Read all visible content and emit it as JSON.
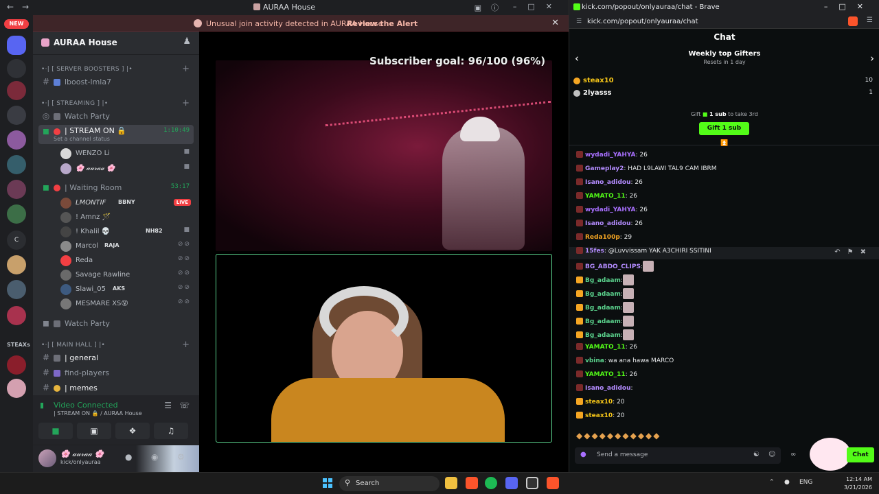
{
  "discord": {
    "window_title": "AURAA House",
    "alert": {
      "text": "Unusual join activity detected in AURAA House",
      "action": "Review the Alert"
    },
    "rail": {
      "new_badge": "NEW",
      "letter": "C",
      "label": "STEAXs"
    },
    "guild_name": "AURAA House",
    "categories": {
      "boosters": "•·| [ SERVER BOOSTERS ] |•",
      "streaming": "•·| [ STREAMING ] |•",
      "main_hall": "•·| [ MAIN HALL ] |•"
    },
    "channels": {
      "boost": "lboost-lmla7",
      "watch_party_1": "Watch Party",
      "stream_on": "| STREAM ON 🔒",
      "stream_on_time": "1:10:49",
      "stream_on_status": "Set a channel status",
      "waiting_room": "| Waiting Room",
      "waiting_room_time": "53:17",
      "watch_party_2": "Watch Party",
      "general": "| general",
      "find_players": "find-players",
      "memes": "| memes"
    },
    "stream_users": [
      {
        "name": "WENZO Li"
      },
      {
        "name": "🌸 𝒶𝓊𝓇𝒶𝒶 🌸"
      }
    ],
    "waiting_users": [
      {
        "name": "LMONTIF",
        "tag": "BBNY",
        "live": "LIVE"
      },
      {
        "name": "! Amnz 🪄",
        "tag": ""
      },
      {
        "name": "! Khalil 💀",
        "tag": "NH82"
      },
      {
        "name": "Marcol",
        "tag": "RAJA"
      },
      {
        "name": "Reda",
        "tag": ""
      },
      {
        "name": "Savage Rawline",
        "tag": ""
      },
      {
        "name": "Slawi_05",
        "tag": "AKS"
      },
      {
        "name": "MESMARE XS😵",
        "tag": ""
      }
    ],
    "voice": {
      "title": "Video Connected",
      "sub": "| STREAM ON 🔒 / AURAA House"
    },
    "user": {
      "name": "🌸 𝒶𝓊𝓇𝒶𝒶 🌸",
      "status": "kick/onlyauraa"
    },
    "stream_overlay": "Subscriber goal: 96/100 (96%)"
  },
  "browser": {
    "title": "kick.com/popout/onlyauraa/chat - Brave",
    "url": "kick.com/popout/onlyauraa/chat",
    "chat_header": "Chat",
    "gifters_title": "Weekly top Gifters",
    "gifters_sub": "Resets in 1 day",
    "gifters": [
      {
        "name": "steax10",
        "count": "10",
        "color": "#f5c518"
      },
      {
        "name": "2lyasss",
        "count": "1",
        "color": "#ffffff"
      }
    ],
    "gift_hint_pre": "Gift",
    "gift_hint_sub": "1 sub",
    "gift_hint_post": "to take 3rd",
    "gift_button": "Gift 1 sub",
    "messages": [
      {
        "name": "wydadi_YAHYA",
        "color": "#a970ff",
        "text": ": 26"
      },
      {
        "name": "Gameplay2",
        "color": "#b48cff",
        "text": ": HAD L9LAWI TAL9 CAM IBRM"
      },
      {
        "name": "Isano_adidou",
        "color": "#b48cff",
        "text": ": 26"
      },
      {
        "name": "YAMATO_11",
        "color": "#53fc18",
        "text": ": 26"
      },
      {
        "name": "wydadi_YAHYA",
        "color": "#a970ff",
        "text": ": 26"
      },
      {
        "name": "Isano_adidou",
        "color": "#b48cff",
        "text": ": 26"
      },
      {
        "name": "Reda100p",
        "color": "#f5a623",
        "text": ": 29"
      },
      {
        "name": "15fes",
        "color": "#b48cff",
        "text": ": @Luvvissam YAK A3CHIRI SSITINI"
      },
      {
        "name": "BG_ABDO_CLIPS",
        "color": "#b48cff",
        "text": ":"
      },
      {
        "name": "Bg_adaam",
        "color": "#5bd38d",
        "text": ":"
      },
      {
        "name": "Bg_adaam",
        "color": "#5bd38d",
        "text": ":"
      },
      {
        "name": "Bg_adaam",
        "color": "#5bd38d",
        "text": ":"
      },
      {
        "name": "Bg_adaam",
        "color": "#5bd38d",
        "text": ":"
      },
      {
        "name": "Bg_adaam",
        "color": "#5bd38d",
        "text": ":"
      },
      {
        "name": "YAMATO_11",
        "color": "#53fc18",
        "text": ": 26"
      },
      {
        "name": "vbina",
        "color": "#5bd38d",
        "text": ": wa ana hawa MARCO"
      },
      {
        "name": "YAMATO_11",
        "color": "#53fc18",
        "text": ": 26"
      },
      {
        "name": "Isano_adidou",
        "color": "#b48cff",
        "text": ":"
      },
      {
        "name": "steax10",
        "color": "#f5c518",
        "text": ": 20"
      },
      {
        "name": "steax10",
        "color": "#f5c518",
        "text": ": 20"
      }
    ],
    "input_placeholder": "Send a message",
    "chat_button": "Chat"
  },
  "taskbar": {
    "search": "Search",
    "lang": "ENG",
    "time": "12:14 AM",
    "date": "3/21/2026"
  }
}
